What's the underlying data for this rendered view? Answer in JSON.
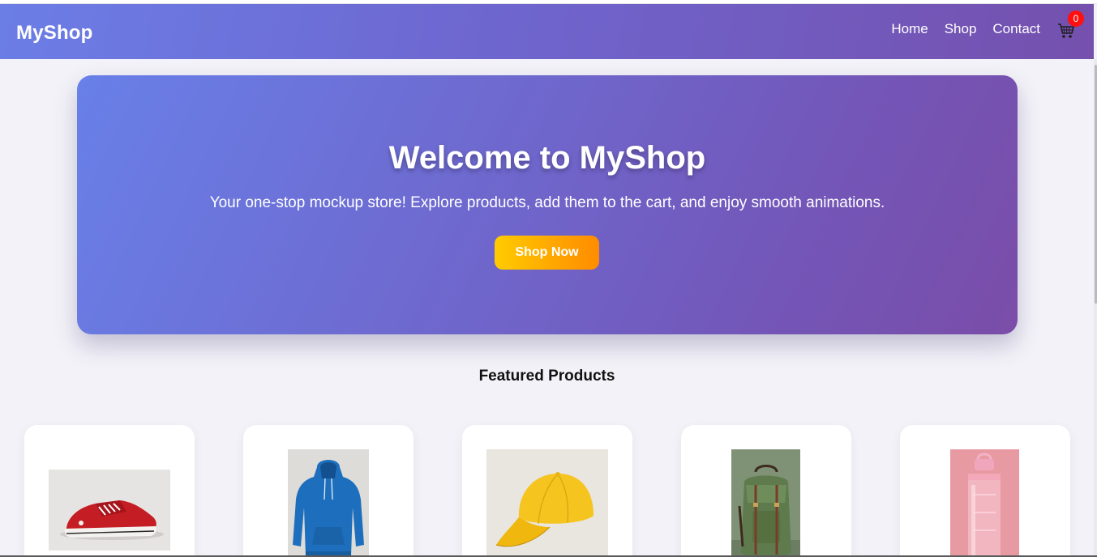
{
  "nav": {
    "brand": "MyShop",
    "links": [
      "Home",
      "Shop",
      "Contact"
    ],
    "cart_count": "0",
    "cart_icon": "shopping-cart-icon"
  },
  "hero": {
    "title": "Welcome to MyShop",
    "subtitle": "Your one-stop mockup store! Explore products, add them to the cart, and enjoy smooth animations.",
    "button_label": "Shop Now"
  },
  "featured": {
    "title": "Featured Products",
    "products": [
      {
        "image": "red-sneaker-image"
      },
      {
        "image": "blue-hoodie-image"
      },
      {
        "image": "yellow-cap-image"
      },
      {
        "image": "green-backpack-image"
      },
      {
        "image": "pink-water-bottle-image"
      }
    ]
  },
  "colors": {
    "accent_gradient_start": "#6b7ee6",
    "accent_gradient_end": "#7550ad",
    "button_start": "#ffcc00",
    "button_end": "#ff8c00",
    "badge": "#ff0f0f",
    "page_background": "#f3f2f8"
  }
}
